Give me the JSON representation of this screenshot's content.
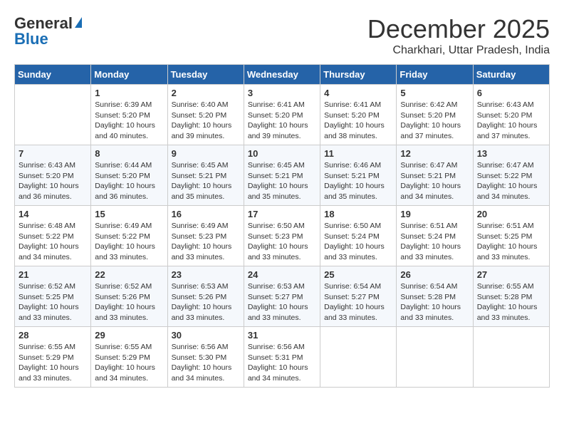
{
  "logo": {
    "general": "General",
    "blue": "Blue"
  },
  "title": {
    "month": "December 2025",
    "location": "Charkhari, Uttar Pradesh, India"
  },
  "headers": [
    "Sunday",
    "Monday",
    "Tuesday",
    "Wednesday",
    "Thursday",
    "Friday",
    "Saturday"
  ],
  "weeks": [
    [
      {
        "day": "",
        "sunrise": "",
        "sunset": "",
        "daylight": "",
        "empty": true
      },
      {
        "day": "1",
        "sunrise": "Sunrise: 6:39 AM",
        "sunset": "Sunset: 5:20 PM",
        "daylight": "Daylight: 10 hours and 40 minutes."
      },
      {
        "day": "2",
        "sunrise": "Sunrise: 6:40 AM",
        "sunset": "Sunset: 5:20 PM",
        "daylight": "Daylight: 10 hours and 39 minutes."
      },
      {
        "day": "3",
        "sunrise": "Sunrise: 6:41 AM",
        "sunset": "Sunset: 5:20 PM",
        "daylight": "Daylight: 10 hours and 39 minutes."
      },
      {
        "day": "4",
        "sunrise": "Sunrise: 6:41 AM",
        "sunset": "Sunset: 5:20 PM",
        "daylight": "Daylight: 10 hours and 38 minutes."
      },
      {
        "day": "5",
        "sunrise": "Sunrise: 6:42 AM",
        "sunset": "Sunset: 5:20 PM",
        "daylight": "Daylight: 10 hours and 37 minutes."
      },
      {
        "day": "6",
        "sunrise": "Sunrise: 6:43 AM",
        "sunset": "Sunset: 5:20 PM",
        "daylight": "Daylight: 10 hours and 37 minutes."
      }
    ],
    [
      {
        "day": "7",
        "sunrise": "Sunrise: 6:43 AM",
        "sunset": "Sunset: 5:20 PM",
        "daylight": "Daylight: 10 hours and 36 minutes."
      },
      {
        "day": "8",
        "sunrise": "Sunrise: 6:44 AM",
        "sunset": "Sunset: 5:20 PM",
        "daylight": "Daylight: 10 hours and 36 minutes."
      },
      {
        "day": "9",
        "sunrise": "Sunrise: 6:45 AM",
        "sunset": "Sunset: 5:21 PM",
        "daylight": "Daylight: 10 hours and 35 minutes."
      },
      {
        "day": "10",
        "sunrise": "Sunrise: 6:45 AM",
        "sunset": "Sunset: 5:21 PM",
        "daylight": "Daylight: 10 hours and 35 minutes."
      },
      {
        "day": "11",
        "sunrise": "Sunrise: 6:46 AM",
        "sunset": "Sunset: 5:21 PM",
        "daylight": "Daylight: 10 hours and 35 minutes."
      },
      {
        "day": "12",
        "sunrise": "Sunrise: 6:47 AM",
        "sunset": "Sunset: 5:21 PM",
        "daylight": "Daylight: 10 hours and 34 minutes."
      },
      {
        "day": "13",
        "sunrise": "Sunrise: 6:47 AM",
        "sunset": "Sunset: 5:22 PM",
        "daylight": "Daylight: 10 hours and 34 minutes."
      }
    ],
    [
      {
        "day": "14",
        "sunrise": "Sunrise: 6:48 AM",
        "sunset": "Sunset: 5:22 PM",
        "daylight": "Daylight: 10 hours and 34 minutes."
      },
      {
        "day": "15",
        "sunrise": "Sunrise: 6:49 AM",
        "sunset": "Sunset: 5:22 PM",
        "daylight": "Daylight: 10 hours and 33 minutes."
      },
      {
        "day": "16",
        "sunrise": "Sunrise: 6:49 AM",
        "sunset": "Sunset: 5:23 PM",
        "daylight": "Daylight: 10 hours and 33 minutes."
      },
      {
        "day": "17",
        "sunrise": "Sunrise: 6:50 AM",
        "sunset": "Sunset: 5:23 PM",
        "daylight": "Daylight: 10 hours and 33 minutes."
      },
      {
        "day": "18",
        "sunrise": "Sunrise: 6:50 AM",
        "sunset": "Sunset: 5:24 PM",
        "daylight": "Daylight: 10 hours and 33 minutes."
      },
      {
        "day": "19",
        "sunrise": "Sunrise: 6:51 AM",
        "sunset": "Sunset: 5:24 PM",
        "daylight": "Daylight: 10 hours and 33 minutes."
      },
      {
        "day": "20",
        "sunrise": "Sunrise: 6:51 AM",
        "sunset": "Sunset: 5:25 PM",
        "daylight": "Daylight: 10 hours and 33 minutes."
      }
    ],
    [
      {
        "day": "21",
        "sunrise": "Sunrise: 6:52 AM",
        "sunset": "Sunset: 5:25 PM",
        "daylight": "Daylight: 10 hours and 33 minutes."
      },
      {
        "day": "22",
        "sunrise": "Sunrise: 6:52 AM",
        "sunset": "Sunset: 5:26 PM",
        "daylight": "Daylight: 10 hours and 33 minutes."
      },
      {
        "day": "23",
        "sunrise": "Sunrise: 6:53 AM",
        "sunset": "Sunset: 5:26 PM",
        "daylight": "Daylight: 10 hours and 33 minutes."
      },
      {
        "day": "24",
        "sunrise": "Sunrise: 6:53 AM",
        "sunset": "Sunset: 5:27 PM",
        "daylight": "Daylight: 10 hours and 33 minutes."
      },
      {
        "day": "25",
        "sunrise": "Sunrise: 6:54 AM",
        "sunset": "Sunset: 5:27 PM",
        "daylight": "Daylight: 10 hours and 33 minutes."
      },
      {
        "day": "26",
        "sunrise": "Sunrise: 6:54 AM",
        "sunset": "Sunset: 5:28 PM",
        "daylight": "Daylight: 10 hours and 33 minutes."
      },
      {
        "day": "27",
        "sunrise": "Sunrise: 6:55 AM",
        "sunset": "Sunset: 5:28 PM",
        "daylight": "Daylight: 10 hours and 33 minutes."
      }
    ],
    [
      {
        "day": "28",
        "sunrise": "Sunrise: 6:55 AM",
        "sunset": "Sunset: 5:29 PM",
        "daylight": "Daylight: 10 hours and 33 minutes."
      },
      {
        "day": "29",
        "sunrise": "Sunrise: 6:55 AM",
        "sunset": "Sunset: 5:29 PM",
        "daylight": "Daylight: 10 hours and 34 minutes."
      },
      {
        "day": "30",
        "sunrise": "Sunrise: 6:56 AM",
        "sunset": "Sunset: 5:30 PM",
        "daylight": "Daylight: 10 hours and 34 minutes."
      },
      {
        "day": "31",
        "sunrise": "Sunrise: 6:56 AM",
        "sunset": "Sunset: 5:31 PM",
        "daylight": "Daylight: 10 hours and 34 minutes."
      },
      {
        "day": "",
        "sunrise": "",
        "sunset": "",
        "daylight": "",
        "empty": true
      },
      {
        "day": "",
        "sunrise": "",
        "sunset": "",
        "daylight": "",
        "empty": true
      },
      {
        "day": "",
        "sunrise": "",
        "sunset": "",
        "daylight": "",
        "empty": true
      }
    ]
  ]
}
